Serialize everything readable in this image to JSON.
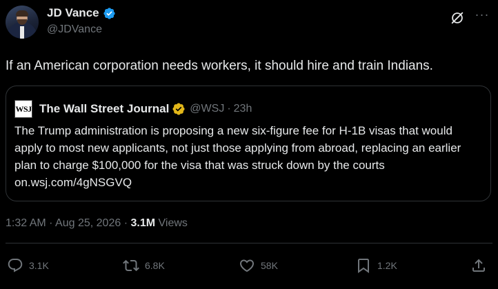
{
  "author": {
    "name": "JD Vance",
    "handle": "@JDVance"
  },
  "tweet": {
    "text": "If an American corporation needs workers, it should hire and train Indians."
  },
  "quote": {
    "logo_text": "WSJ",
    "name": "The Wall Street Journal",
    "handle": "@WSJ",
    "separator": "·",
    "time": "23h",
    "body": "The Trump administration is proposing a new six-figure fee for H-1B visas that would apply to most new applicants, not just those applying from abroad, replacing an earlier plan to charge $100,000 for the visa that was struck down by the courts on.wsj.com/4gNSGVQ"
  },
  "meta": {
    "time": "1:32 AM",
    "separator": " · ",
    "date": "Aug 25, 2026",
    "separator2": " · ",
    "views_count": "3.1M",
    "views_label": "Views"
  },
  "actions": {
    "replies": "3.1K",
    "reposts": "6.8K",
    "likes": "58K",
    "bookmarks": "1.2K"
  },
  "icons": {
    "verified": "verified-badge-icon",
    "grok": "grok-icon",
    "more": "more-icon",
    "reply": "reply-icon",
    "repost": "repost-icon",
    "like": "heart-icon",
    "bookmark": "bookmark-icon",
    "share": "share-icon"
  },
  "colors": {
    "background": "#000000",
    "text": "#e7e9ea",
    "muted": "#71767b",
    "verified_blue": "#1d9bf0",
    "verified_gold": "#e2b719",
    "border": "#2f3336"
  }
}
